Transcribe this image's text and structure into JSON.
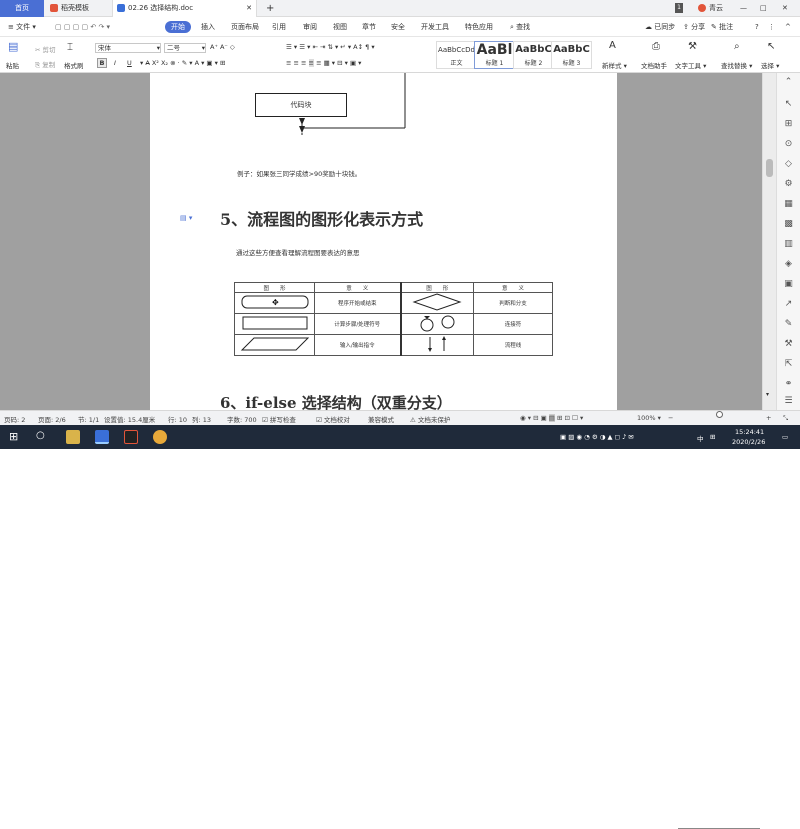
{
  "tabs": {
    "home": "首页",
    "template": "稻壳模板",
    "document": "02.26 选择结构.doc",
    "add": "+"
  },
  "titlebar": {
    "badge": "1",
    "user": "青云"
  },
  "menu": {
    "file": "文件",
    "start": "开始",
    "items": [
      "插入",
      "页面布局",
      "引用",
      "审阅",
      "视图",
      "章节",
      "安全",
      "开发工具",
      "特色应用"
    ],
    "search": "查找",
    "sync": "已同步",
    "share": "分享",
    "comment": "批注",
    "help": "?"
  },
  "ribbon": {
    "paste": "粘贴",
    "cut": "剪切",
    "copy": "复制",
    "format_painter": "格式刷",
    "font": "宋体",
    "size": "二号",
    "bold": "B",
    "italic": "I",
    "underline": "U",
    "styles": [
      {
        "preview": "AaBbCcDd",
        "name": "正文"
      },
      {
        "preview": "AaBl",
        "name": "标题 1"
      },
      {
        "preview": "AaBbC",
        "name": "标题 2"
      },
      {
        "preview": "AaBbC",
        "name": "标题 3"
      }
    ],
    "new_style": "新样式",
    "doc_assistant": "文档助手",
    "text_tools": "文字工具",
    "find_replace": "查找替换",
    "select": "选择"
  },
  "doc": {
    "code_block": "代码块",
    "example": "例子：如果张三同学成绩>90奖励十块钱。",
    "heading5": "5、流程图的图形化表示方式",
    "intro": "通过这些方便查看理解流程图要表达的意思",
    "table": {
      "headers": [
        "图　　形",
        "意　　义",
        "图　　形",
        "意　　义"
      ],
      "rows": [
        [
          "程序开始或结束",
          "判断和分支"
        ],
        [
          "计算步骤/处理符号",
          "连接符"
        ],
        [
          "输入/输出指令",
          "流程线"
        ]
      ]
    },
    "heading6": "6、if-else 选择结构（双重分支）"
  },
  "status": {
    "page": "页码: 2",
    "pages": "页面: 2/6",
    "section": "节: 1/1",
    "setting": "设置值: 15.4厘米",
    "row": "行: 10",
    "col": "列: 13",
    "words": "字数: 700",
    "spell": "拼写检查",
    "proof": "文档校对",
    "compat": "兼容模式",
    "unprotected": "文档未保护",
    "zoom": "100%"
  },
  "taskbar": {
    "time": "15:24:41",
    "date": "2020/2/26",
    "ime": "中"
  }
}
